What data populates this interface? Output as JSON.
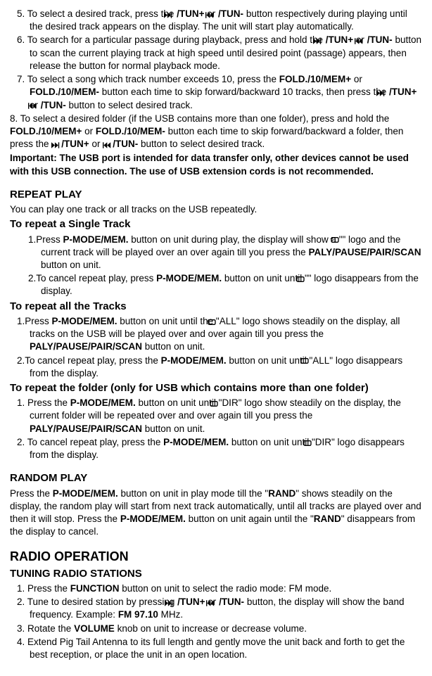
{
  "item5": {
    "prefix": "5.  To select a desired track, press the ",
    "btn1": "/TUN+",
    "mid1": " or ",
    "btn2": "/TUN-",
    "rest": " button respectively during playing until the desired track appears on the display. The unit will start play automatically."
  },
  "item6": {
    "prefix": "6.  To search for a particular passage during playback, press and hold the ",
    "btn1": "/TUN+",
    "mid1": " or ",
    "btn2": "/TUN-",
    "rest": " button to scan the current playing track at high speed until desired point (passage) appears, then release the button for normal playback mode."
  },
  "item7": {
    "prefix": "7.  To select a song which track number exceeds 10, press the ",
    "fold1": "FOLD./10/MEM+",
    "mid1": " or ",
    "fold2": "FOLD./10/MEM-",
    "mid2": " button each time to skip forward/backward 10 tracks, then press the ",
    "btn1": "/TUN+",
    "mid3": " or ",
    "btn2": "/TUN-",
    "rest": " button to select desired track."
  },
  "item8": {
    "prefix": "8. To select a desired folder (if the USB contains more than one folder), press and hold the ",
    "fold1": "FOLD./10/MEM+",
    "mid1": " or ",
    "fold2": "FOLD./10/MEM-",
    "mid2": " button each time to skip forward/backward a folder, then press the ",
    "btn1": "/TUN+",
    "mid3": " or ",
    "btn2": "/TUN-",
    "rest": " button to select desired track."
  },
  "important": "Important: The USB port is intended for data transfer only, other devices cannot be used with this USB connection. The use of USB extension cords is not recommended.",
  "repeat": {
    "heading": "REPEAT PLAY",
    "intro": "You can play one track or all tracks on the USB repeatedly.",
    "single_h": "To repeat a Single Track",
    "single1a": "1.Press ",
    "pmode": "P-MODE/MEM.",
    "single1b": " button on unit during play, the display will show a \"",
    "single1c": "\" logo and the current track will be played over an over again till you press the ",
    "paly": "PALY/PAUSE/PAIR/SCAN",
    "single1d": " button on unit.",
    "single2a": "2.To cancel repeat play, press ",
    "single2b": " button on unit until \"",
    "single2c": "\" logo disappears from the display.",
    "all_h": "To repeat all the Tracks",
    "all1a": "1.Press ",
    "all1b": " button on unit until the \"",
    "all_logo": "ALL",
    "all1c": "\" logo shows steadily on the display, all tracks on the USB will be played over and over again till you press the ",
    "all1d": " button on unit.",
    "all2a": "2.To cancel repeat play, press the ",
    "all2b": " button on unit until \"",
    "all2c": "\" logo disappears from the display.",
    "folder_h": "To repeat the folder (only for USB which contains more than one folder)",
    "f1a": "1.    Press the ",
    "f1b": " button on unit until \"",
    "dir_logo": "DIR",
    "f1c": "\" logo show steadily on the display, the current folder will be repeated over and over again till you press the ",
    "f1d": " button on unit.",
    "f2a": "2.    To cancel repeat play, press the ",
    "f2b": " button on unit until \"",
    "f2c": "\" logo disappears from the display."
  },
  "random": {
    "heading": "RANDOM PLAY",
    "t1": "Press the ",
    "t2": " button on unit in play mode till the \"",
    "rand": "RAND",
    "t3": "\" shows steadily on the display, the random play will start from next track automatically, until all tracks are played over and then it will stop. Press the ",
    "t4": " button on unit again until the \"",
    "t5": "\" disappears from the display to cancel."
  },
  "radio": {
    "heading": "RADIO OPERATION",
    "sub": "TUNING RADIO STATIONS",
    "r1a": "1.    Press the ",
    "func": "FUNCTION",
    "r1b": " button on unit to select the radio mode: FM mode.",
    "r2a": "2.    Tune to desired station by pressing ",
    "r2b": "/TUN+",
    "r2c": " or ",
    "r2d": "/TUN-",
    "r2e": " button, the display will show the band frequency. Example: ",
    "fm": "FM 97.10",
    "r2f": " MHz.",
    "r3a": "3.    Rotate the ",
    "vol": "VOLUME",
    "r3b": " knob on unit to increase or decrease volume.",
    "r4": "4.    Extend Pig Tail Antenna to its full length and gently move the unit back and forth to get the best reception, or place the unit in an open location."
  }
}
